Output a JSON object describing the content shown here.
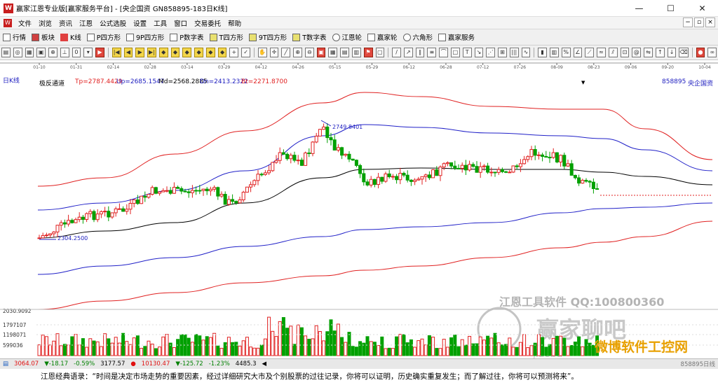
{
  "window": {
    "title": "赢家江恩专业版[赢家服务平台] - [央企国资  GN858895-183日K线]",
    "minimize": "—",
    "maximize": "☐",
    "close": "✕"
  },
  "menu": [
    "文件",
    "浏览",
    "资讯",
    "江恩",
    "公式选股",
    "设置",
    "工具",
    "窗口",
    "交易委托",
    "帮助"
  ],
  "mdi": [
    "−",
    "▫",
    "×"
  ],
  "toolbar1": [
    {
      "label": "行情",
      "icon": "grid-icon"
    },
    {
      "label": "板块",
      "icon": "blocks-icon"
    },
    {
      "label": "K线",
      "icon": "candles-icon"
    },
    {
      "label": "P四方形",
      "icon": "p-square-icon"
    },
    {
      "label": "9P四方形",
      "icon": "9p-square-icon"
    },
    {
      "label": "P数字表",
      "icon": "p-table-icon"
    },
    {
      "label": "T四方形",
      "icon": "t-square-icon"
    },
    {
      "label": "9T四方形",
      "icon": "9t-square-icon"
    },
    {
      "label": "T数字表",
      "icon": "t-table-icon"
    },
    {
      "label": "江恩轮",
      "icon": "gann-wheel-icon"
    },
    {
      "label": "赢家轮",
      "icon": "winner-wheel-icon"
    },
    {
      "label": "六角形",
      "icon": "hexagon-icon"
    },
    {
      "label": "赢家服务",
      "icon": "service-icon"
    }
  ],
  "toolbar2_zoom": "0",
  "dates": [
    "01-10",
    "01-31",
    "02-14",
    "02-28",
    "03-14",
    "03-29",
    "04-12",
    "04-26",
    "05-15",
    "05-29",
    "06-12",
    "06-28",
    "07-12",
    "07-26",
    "08-09",
    "08-23",
    "09-06",
    "09-20",
    "10-04"
  ],
  "header": {
    "period": "日K线",
    "indicator": "极反通道",
    "tp": "Tp=2787.4429",
    "up": "Up=2685.1547",
    "md": "Md=2568.2885",
    "dn": "Dn=2413.2322",
    "bt": "Bt=2271.8700",
    "code": "858895",
    "name": "央企国资"
  },
  "chart_data": {
    "type": "candlestick",
    "annotations": {
      "high": "2749.8401",
      "low": "2304.2500"
    },
    "volume_axis": [
      "2030.9092",
      "1797107",
      "1198071",
      "599036"
    ],
    "colors": {
      "up": "#e02020",
      "down": "#00a000",
      "outer_band": "#e02020",
      "inner_band": "#2020c8",
      "mid": "#000000"
    }
  },
  "watermark": {
    "line1": "江恩工具软件  QQ:100800360",
    "line2": "赢家聊吧",
    "line3": "jiaoba",
    "corner": "微博软件工控网"
  },
  "status": {
    "sh_index": "3064.07",
    "sh_change": "▼-18.17",
    "sh_pct": "-0.59%",
    "sh_amount": "3177.57",
    "sz_index": "10130.47",
    "sz_change": "▼-125.72",
    "sz_pct": "-1.23%",
    "sz_amount": "4485.3",
    "right": "858895日线"
  },
  "quote": "江恩经典语录：“时间是决定市场走势的重要因素，经过详细研究大市及个别股票的过往记录，你将可以证明，历史确实重复发生；而了解过往，你将可以预测将来”。"
}
